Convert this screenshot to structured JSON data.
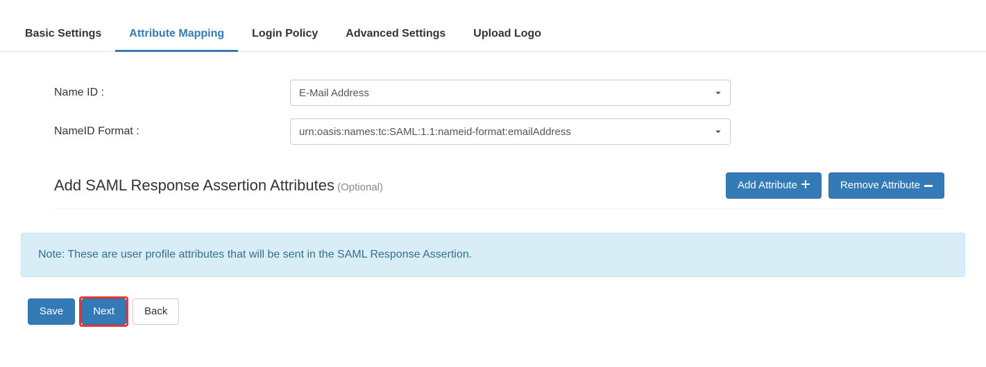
{
  "tabs": [
    {
      "label": "Basic Settings",
      "active": false
    },
    {
      "label": "Attribute Mapping",
      "active": true
    },
    {
      "label": "Login Policy",
      "active": false
    },
    {
      "label": "Advanced Settings",
      "active": false
    },
    {
      "label": "Upload Logo",
      "active": false
    }
  ],
  "fields": {
    "name_id_label": "Name ID :",
    "name_id_value": "E-Mail Address",
    "nameid_format_label": "NameID Format :",
    "nameid_format_value": "urn:oasis:names:tc:SAML:1.1:nameid-format:emailAddress"
  },
  "section": {
    "title": "Add SAML Response Assertion Attributes",
    "optional": "(Optional)",
    "add_btn": "Add Attribute",
    "remove_btn": "Remove Attribute"
  },
  "note": "Note: These are user profile attributes that will be sent in the SAML Response Assertion.",
  "footer": {
    "save": "Save",
    "next": "Next",
    "back": "Back"
  }
}
